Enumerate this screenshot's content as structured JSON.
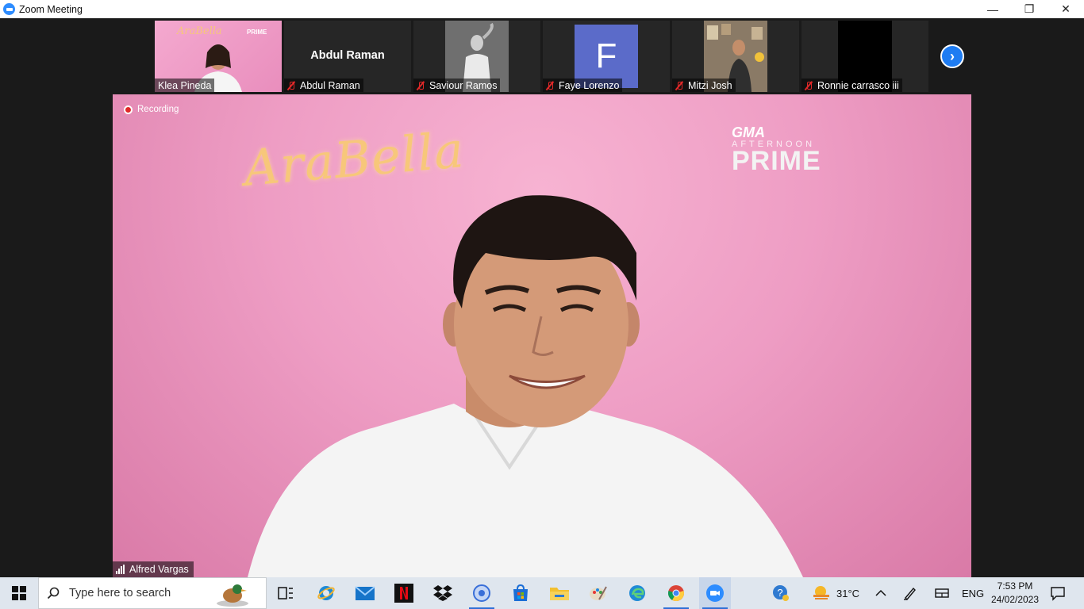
{
  "window": {
    "title": "Zoom Meeting",
    "minimize": "—",
    "restore": "❐",
    "close": "✕"
  },
  "gallery": {
    "tiles": [
      {
        "name": "Klea Pineda",
        "muted": false
      },
      {
        "name": "Abdul Raman",
        "muted": true,
        "display_name": "Abdul Raman"
      },
      {
        "name": "Saviour Ramos",
        "muted": true
      },
      {
        "name": "Faye Lorenzo",
        "muted": true,
        "avatar_letter": "F"
      },
      {
        "name": "Mitzi Josh",
        "muted": true
      },
      {
        "name": "Ronnie carrasco iii",
        "muted": true
      }
    ],
    "next_icon": "›",
    "thumb_brand_small": "AraBella",
    "thumb_brand_prime": "PRIME"
  },
  "main": {
    "recording_label": "Recording",
    "speaker_name": "Alfred Vargas",
    "backdrop_logo": "AraBella",
    "network_logo_gma": "GMA",
    "network_logo_sub": "AFTERNOON",
    "network_logo_prime": "PRIME"
  },
  "taskbar": {
    "search_placeholder": "Type here to search",
    "weather": "31°C",
    "language": "ENG",
    "time": "7:53 PM",
    "date": "24/02/2023"
  },
  "colors": {
    "zoom_blue": "#2d8cff",
    "mute_red": "#e02828",
    "pink_backdrop": "#ee9dc4",
    "avatar_purple": "#5b6bc9"
  }
}
